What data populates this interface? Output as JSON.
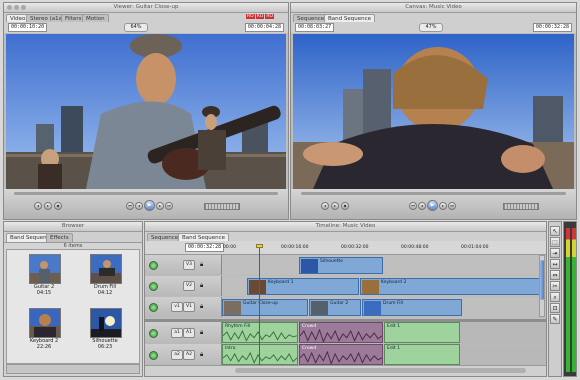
{
  "viewer": {
    "title": "Viewer: Guitar Close-up",
    "tabs": [
      "Video",
      "Stereo (a1a2)",
      "Filters",
      "Motion"
    ],
    "timecode_left": "00:00:10:20",
    "zoom": "64%",
    "timecode_right": "00:00:04:28",
    "badges": [
      "RO",
      "RO",
      "RO"
    ]
  },
  "canvas": {
    "title": "Canvas: Music Video",
    "tabs": [
      "Sequence 1",
      "Band Sequence"
    ],
    "timecode_left": "00:08:03:27",
    "zoom": "47%",
    "timecode_right": "00:00:32:28"
  },
  "browser": {
    "title": "Browser",
    "tabs": [
      "Band Sequence",
      "Effects"
    ],
    "count": "6 items",
    "clips": [
      {
        "name": "Guitar 2",
        "duration": "04:15"
      },
      {
        "name": "Drum Fill",
        "duration": "04:12"
      },
      {
        "name": "Keyboard 2",
        "duration": "22:26"
      },
      {
        "name": "Silhouette",
        "duration": "06:23"
      }
    ]
  },
  "timeline": {
    "title": "Timeline: Music Video",
    "tabs": [
      "Sequence 1",
      "Band Sequence"
    ],
    "timecode": "00:00:32:28",
    "ruler": [
      "00:00",
      "00:00:16:00",
      "00:00:32:00",
      "00:00:48:00",
      "00:01:04:00"
    ],
    "video_tracks": [
      {
        "label": "V3",
        "src": "",
        "clips": [
          {
            "name": "Silhouette"
          }
        ]
      },
      {
        "label": "V2",
        "src": "",
        "clips": [
          {
            "name": "Keyboard 1"
          },
          {
            "name": "Keyboard 2"
          }
        ]
      },
      {
        "label": "V1",
        "src": "v1",
        "clips": [
          {
            "name": "Guitar Close-up"
          },
          {
            "name": "Guitar 2"
          },
          {
            "name": "Drum Fill"
          }
        ]
      }
    ],
    "audio_tracks": [
      {
        "label": "A1",
        "src": "a1",
        "clips": [
          {
            "name": "Rhythm Fill"
          },
          {
            "name": "Crowd"
          },
          {
            "name": "Edit 1"
          }
        ]
      },
      {
        "label": "A2",
        "src": "a2",
        "clips": [
          {
            "name": "Intro"
          },
          {
            "name": "Crowd"
          },
          {
            "name": "Edit 1"
          }
        ]
      }
    ]
  },
  "colors": {
    "clip_video": "#7fa8d6",
    "clip_audio_green": "#9ed39e",
    "clip_audio_purple": "#9c7a9a",
    "window_bg": "#bdbdbd"
  }
}
